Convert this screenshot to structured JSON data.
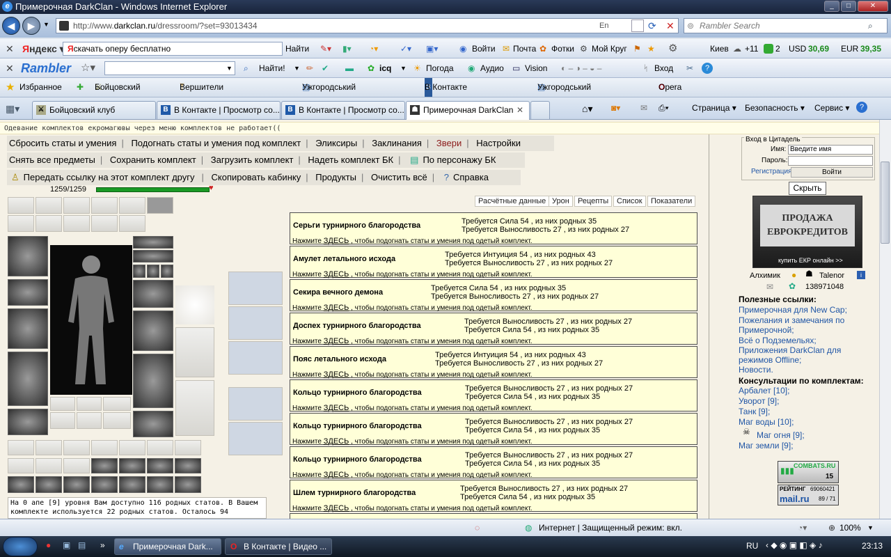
{
  "window": {
    "title": "Примерочная DarkClan - Windows Internet Explorer",
    "url_prefix": "http://www.",
    "url_domain": "darkclan.ru",
    "url_path": "/dressroom/?set=93013434",
    "lang": "En",
    "search_placeholder": "Rambler Search"
  },
  "yandex_bar": {
    "logo": "Яндекс",
    "query": "скачать оперу бесплатно",
    "find": "Найти",
    "login": "Войти",
    "mail": "Почта",
    "photos": "Фотки",
    "circle": "Мой Круг",
    "city": "Киев",
    "temp": "+11",
    "traffic": "2",
    "usd_label": "USD",
    "usd": "30,69",
    "eur_label": "EUR",
    "eur": "39,35"
  },
  "rambler_bar": {
    "logo": "Rambler",
    "find": "Найти!",
    "icq": "icq",
    "weather": "Погода",
    "audio": "Аудио",
    "vision": "Vision",
    "login": "Вход"
  },
  "favorites": {
    "label": "Избранное",
    "links": [
      "Бойцовский клуб",
      "Вершители Судеб - Нов...",
      "Ужгородський національ...",
      "В Контакте Фотографии",
      "Ужгородський національ...",
      "Opera Mini - Загрузить n..."
    ]
  },
  "tabs": [
    "Бойцовский клуб",
    "В Контакте | Просмотр со...",
    "В Контакте | Просмотр со...",
    "Примерочная DarkClan"
  ],
  "commands": [
    "Страница",
    "Безопасность",
    "Сервис"
  ],
  "page": {
    "notice": "Одевание комплектов екромагювы через меню комплектов не работает((",
    "menu1": [
      "Сбросить статы и умения",
      "Подогнать статы и умения под комплект",
      "Эликсиры",
      "Заклинания",
      "Звери",
      "Настройки"
    ],
    "menu2": [
      "Снять все предметы",
      "Сохранить комплект",
      "Загрузить комплект",
      "Надеть комплект БК",
      "По персонажу БК"
    ],
    "menu3": [
      "Передать ссылку на этот комплект другу",
      "Скопировать кабинку",
      "Продукты",
      "Очистить всё",
      "Справка"
    ],
    "hp": "1259/1259",
    "subtabs": [
      "Расчётные данные",
      "Урон",
      "Рецепты",
      "Список",
      "Показатели"
    ],
    "hint_prefix": "Нажмите ",
    "hint_link": "ЗДЕСЬ",
    "hint_suffix": " , чтобы подогнать статы и умения под одетый комплект.",
    "items": [
      {
        "name": "Серьги турнирного благородства",
        "r1": "Требуется Сила 54 , из них родных 35",
        "r2": "Требуется Выносливость 27 , из них родных 27"
      },
      {
        "name": "Амулет летального исхода",
        "r1": "Требуется Интуиция 54 , из них родных 43",
        "r2": "Требуется Выносливость 27 , из них родных 27"
      },
      {
        "name": "Секира вечного демона",
        "r1": "Требуется Сила 54 , из них родных 35",
        "r2": "Требуется Выносливость 27 , из них родных 27"
      },
      {
        "name": "Доспех турнирного благородства",
        "r1": "Требуется Выносливость 27 , из них родных 27",
        "r2": "Требуется Сила 54 , из них родных 35"
      },
      {
        "name": "Пояс летального исхода",
        "r1": "Требуется Интуиция 54 , из них родных 43",
        "r2": "Требуется Выносливость 27 , из них родных 27"
      },
      {
        "name": "Кольцо турнирного благородства",
        "r1": "Требуется Выносливость 27 , из них родных 27",
        "r2": "Требуется Сила 54 , из них родных 35"
      },
      {
        "name": "Кольцо турнирного благородства",
        "r1": "Требуется Выносливость 27 , из них родных 27",
        "r2": "Требуется Сила 54 , из них родных 35"
      },
      {
        "name": "Кольцо турнирного благородства",
        "r1": "Требуется Выносливость 27 , из них родных 27",
        "r2": "Требуется Сила 54 , из них родных 35"
      },
      {
        "name": "Шлем турнирного благородства",
        "r1": "Требуется Выносливость 27 , из них родных 27",
        "r2": "Требуется Сила 54 , из них родных 35"
      }
    ],
    "stats_line1": "На 0 апе [9] уровня Вам доступно 116 родных статов. В Вашем",
    "stats_line2": "комплекте используется 22 родных статов. Осталось 94 свободных"
  },
  "sidebar": {
    "login_title": "Вход в Цитадель",
    "name_label": "Имя:",
    "name_value": "Введите имя",
    "pass_label": "Пароль:",
    "register": "Регистрация",
    "enter": "Войти",
    "hide": "Скрыть",
    "ad_line1": "ПРОДАЖА",
    "ad_line2": "ЕВРОКРЕДИТОВ",
    "ad_buy": "купить ЕКР онлайн  >>",
    "user1": "Алхимик",
    "user2": "Talenor",
    "icq": "138971048",
    "useful_title": "Полезные ссылки:",
    "useful": [
      "Примерочная для New Cap",
      "Пожелания и замечания по Примерочной",
      "Всё о Подземельях",
      "Приложения DarkClan для режимов Offline",
      "Новости"
    ],
    "consult_title": "Консультации по комплектам:",
    "consult": [
      "Арбалет [10]",
      "Уворот [9]",
      "Танк [9]",
      "Маг воды [10]",
      "Маг огня [9]",
      "Маг земли [9]"
    ],
    "counter_name": "COMBATS.RU",
    "counter_num": "15",
    "rating_label": "РЕЙТИНГ",
    "rating_value": "69060421",
    "mail_logo": "mail.ru",
    "mail_nums": "89 / 71"
  },
  "status": {
    "zone": "Интернет | Защищенный режим: вкл.",
    "zoom": "100%"
  },
  "taskbar": {
    "tasks": [
      "Примерочная Dark...",
      "В Контакте | Видео ..."
    ],
    "lang": "RU",
    "time": "23:13"
  }
}
